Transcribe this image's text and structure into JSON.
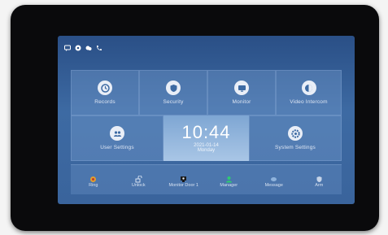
{
  "status_icons": [
    "message-icon",
    "settings-icon",
    "cloud-icon",
    "phone-icon"
  ],
  "tiles_top": [
    {
      "label": "Records",
      "icon": "records-icon"
    },
    {
      "label": "Security",
      "icon": "security-icon"
    },
    {
      "label": "Monitor",
      "icon": "monitor-icon"
    },
    {
      "label": "Video Intercom",
      "icon": "video-intercom-icon"
    }
  ],
  "tiles_mid": [
    {
      "label": "User Settings",
      "icon": "user-settings-icon"
    },
    {
      "label": "System Settings",
      "icon": "system-settings-icon"
    }
  ],
  "clock": {
    "time": "10:44",
    "date": "2021-01-14",
    "day": "Monday"
  },
  "bottom_bar": [
    {
      "label": "Ring",
      "icon": "bell-icon"
    },
    {
      "label": "Unlock",
      "icon": "unlock-icon"
    },
    {
      "label": "Monitor Door 1",
      "icon": "camera-icon"
    },
    {
      "label": "Manager",
      "icon": "manager-icon"
    },
    {
      "label": "Message",
      "icon": "message-icon"
    },
    {
      "label": "Arm",
      "icon": "arm-icon"
    }
  ],
  "colors": {
    "screen_top": "#2a4f86",
    "screen_bottom": "#3a649c",
    "tile": "#6f9bcf",
    "text": "#dfe7f4"
  }
}
